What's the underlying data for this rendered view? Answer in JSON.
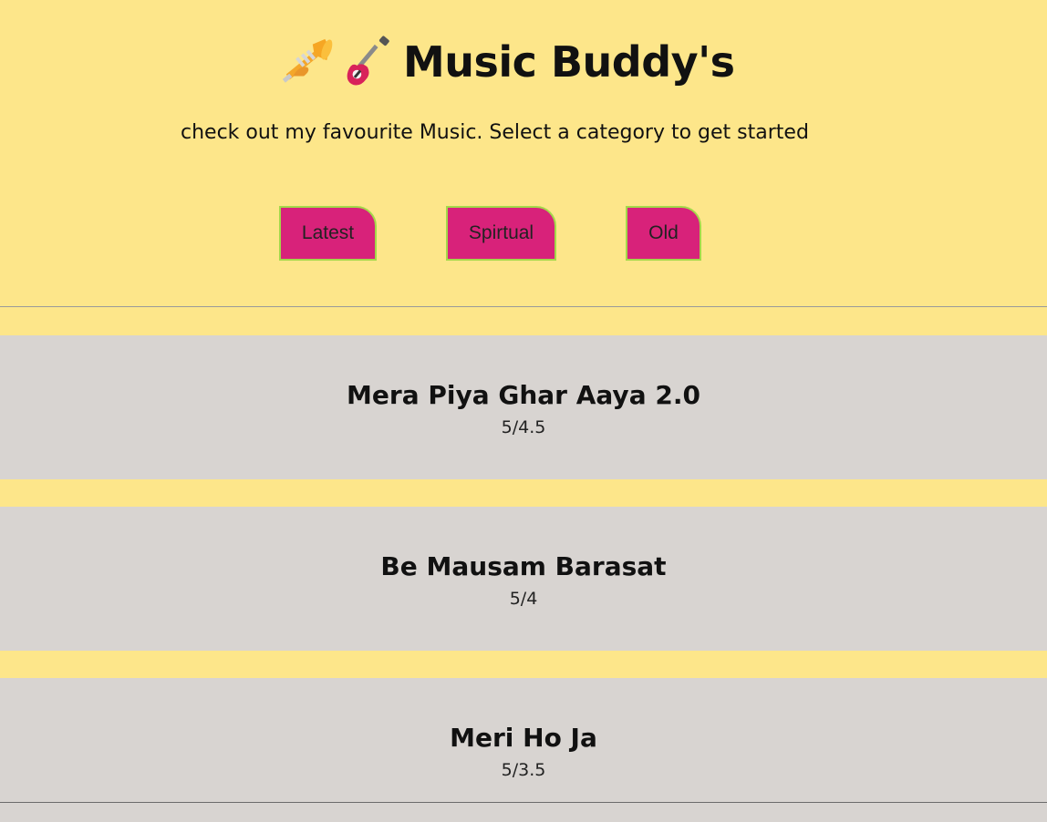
{
  "header": {
    "title": "Music Buddy's",
    "title_icons": [
      "trumpet-icon",
      "guitar-icon"
    ],
    "tagline": "check out my favourite Music. Select a category to get started"
  },
  "categories": [
    {
      "label": "Latest"
    },
    {
      "label": "Spirtual"
    },
    {
      "label": "Old"
    }
  ],
  "songs": [
    {
      "name": "Mera Piya Ghar Aaya 2.0",
      "rating": "5/4.5"
    },
    {
      "name": "Be Mausam Barasat",
      "rating": "5/4"
    },
    {
      "name": "Meri Ho Ja",
      "rating": "5/3.5"
    }
  ],
  "colors": {
    "background": "#fde68a",
    "button": "#d8227a",
    "button_border": "#a3d94a",
    "card": "#d8d4d1"
  }
}
